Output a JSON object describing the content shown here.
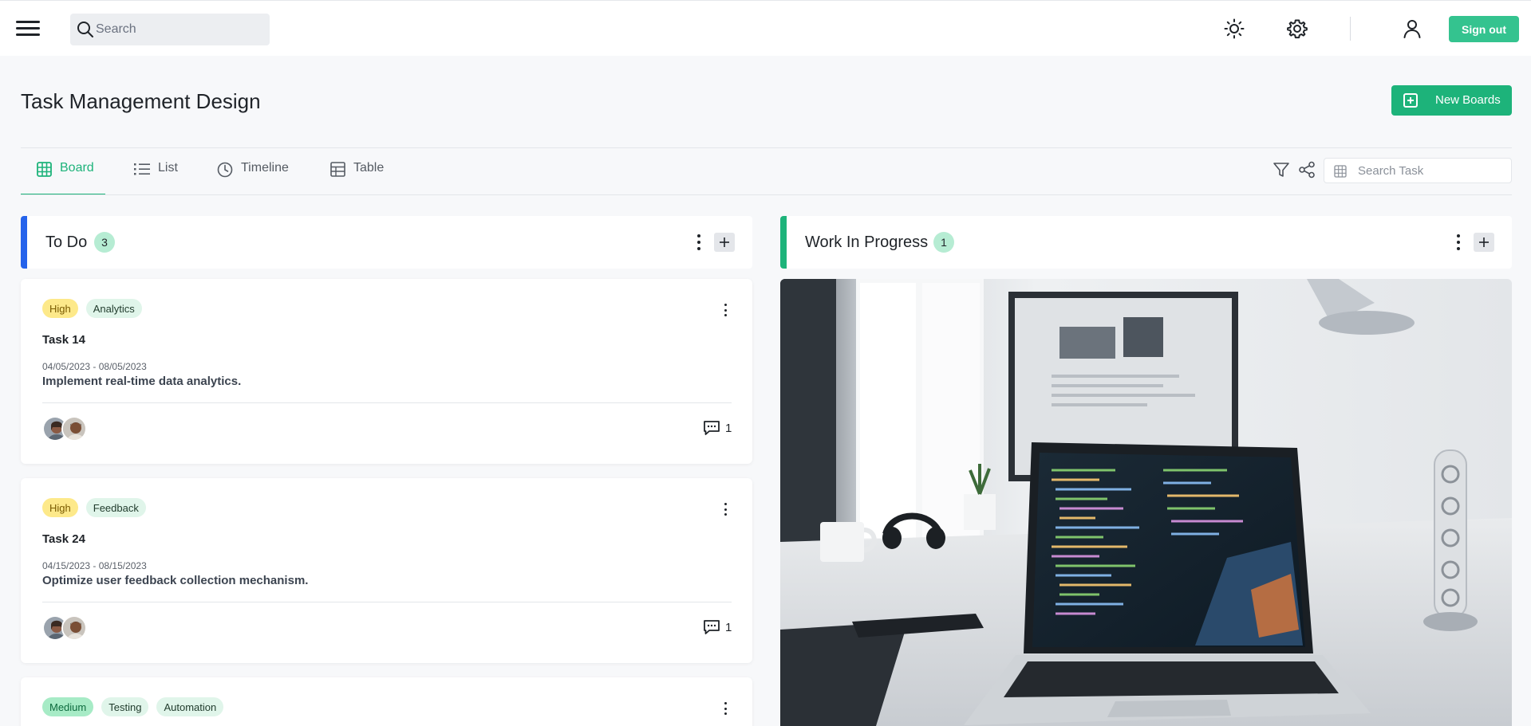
{
  "header": {
    "search_placeholder": "Search",
    "signout_label": "Sign out",
    "icons": [
      "menu-icon",
      "search-icon",
      "sun-icon",
      "gear-icon",
      "user-icon"
    ]
  },
  "page": {
    "title": "Task Management Design",
    "new_boards_label": "New Boards"
  },
  "tabs": [
    {
      "label": "Board",
      "icon": "grid-icon",
      "active": true
    },
    {
      "label": "List",
      "icon": "list-icon",
      "active": false
    },
    {
      "label": "Timeline",
      "icon": "clock-icon",
      "active": false
    },
    {
      "label": "Table",
      "icon": "table-icon",
      "active": false
    }
  ],
  "task_search": {
    "placeholder": "Search Task"
  },
  "columns": [
    {
      "title": "To Do",
      "count": "3",
      "accent": "#2563eb"
    },
    {
      "title": "Work In Progress",
      "count": "1",
      "accent": "#1db37a"
    }
  ],
  "cards": [
    {
      "priority": "High",
      "tags": [
        "Analytics"
      ],
      "name": "Task 14",
      "dates": "04/05/2023 - 08/05/2023",
      "description": "Implement real-time data analytics.",
      "comments": "1"
    },
    {
      "priority": "High",
      "tags": [
        "Feedback"
      ],
      "name": "Task 24",
      "dates": "04/15/2023 - 08/15/2023",
      "description": "Optimize user feedback collection mechanism.",
      "comments": "1"
    },
    {
      "priority": "Medium",
      "tags": [
        "Testing",
        "Automation"
      ]
    }
  ],
  "colors": {
    "primary": "#1db37a",
    "signout": "#34c38f",
    "todo_accent": "#2563eb",
    "high_tag": "#fde98a",
    "medium_tag": "#a7ebc6"
  }
}
